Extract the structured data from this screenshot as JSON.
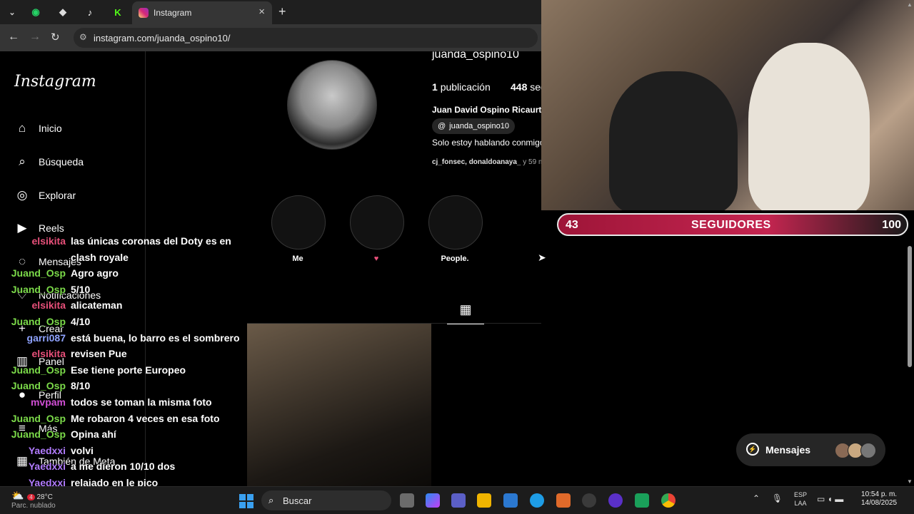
{
  "browser": {
    "tab_title": "Instagram",
    "url": "instagram.com/juanda_ospino10/"
  },
  "instagram": {
    "logo": "Instagram",
    "nav": [
      {
        "label": "Inicio",
        "icon": "home-icon"
      },
      {
        "label": "Búsqueda",
        "icon": "search-icon"
      },
      {
        "label": "Explorar",
        "icon": "compass-icon"
      },
      {
        "label": "Reels",
        "icon": "reels-icon"
      },
      {
        "label": "Mensajes",
        "icon": "messenger-icon"
      },
      {
        "label": "Notificaciones",
        "icon": "heart-icon"
      },
      {
        "label": "Crear",
        "icon": "plus-icon"
      },
      {
        "label": "Panel",
        "icon": "chart-icon"
      },
      {
        "label": "Perfil",
        "icon": "avatar-icon"
      },
      {
        "label": "Más",
        "icon": "menu-icon"
      },
      {
        "label": "También de Meta",
        "icon": "meta-icon"
      }
    ],
    "profile": {
      "username": "juanda_ospino10",
      "posts_count": "1",
      "posts_label": "publicación",
      "followers_count": "448",
      "followers_label": "seg",
      "full_name": "Juan David Ospino Ricaurte",
      "threads_handle": "juanda_ospino10",
      "bio": "Solo estoy hablando conmigo",
      "mutual_names": "cj_fonsec, donaldoanaya_",
      "mutual_more": " y 59 má"
    },
    "highlights": [
      {
        "label": "Me"
      },
      {
        "label": "♥"
      },
      {
        "label": "People."
      }
    ],
    "messages_bar": {
      "label": "Mensajes"
    }
  },
  "stream_overlay": {
    "current": "43",
    "label": "SEGUIDORES",
    "goal": "100",
    "bar_color": "#c42550"
  },
  "chat": [
    {
      "user": "elsikita",
      "msg": "las únicas coronas del Doty es en",
      "color": "#e8507a"
    },
    {
      "user": "",
      "msg": "clash royale",
      "color": "#e8507a"
    },
    {
      "user": "Juand_Osp",
      "msg": "Agro agro",
      "color": "#7cdb4a"
    },
    {
      "user": "Juand_Osp",
      "msg": "5/10",
      "color": "#7cdb4a"
    },
    {
      "user": "elsikita",
      "msg": "alicateman",
      "color": "#e8507a"
    },
    {
      "user": "Juand_Osp",
      "msg": "4/10",
      "color": "#7cdb4a"
    },
    {
      "user": "garri087",
      "msg": "está buena, lo barro es el sombrero",
      "color": "#8fa3ff"
    },
    {
      "user": "elsikita",
      "msg": "revisen Pue",
      "color": "#e8507a"
    },
    {
      "user": "Juand_Osp",
      "msg": "Ese tiene porte Europeo",
      "color": "#7cdb4a"
    },
    {
      "user": "Juand_Osp",
      "msg": "8/10",
      "color": "#7cdb4a"
    },
    {
      "user": "mvpam",
      "msg": "todos se toman la misma foto",
      "color": "#d24fd6"
    },
    {
      "user": "Juand_Osp",
      "msg": "Me robaron 4 veces en esa foto",
      "color": "#7cdb4a"
    },
    {
      "user": "Juand_Osp",
      "msg": "Opina ahí",
      "color": "#7cdb4a"
    },
    {
      "user": "Yaedxxi",
      "msg": "volvi",
      "color": "#b27cff"
    },
    {
      "user": "Yaedxxi",
      "msg": "a me dieron 10/10 dos",
      "color": "#b27cff"
    },
    {
      "user": "Yaedxxi",
      "msg": "relajado en le pico",
      "color": "#b27cff"
    }
  ],
  "taskbar": {
    "temp": "28°C",
    "weather": "Parc. nublado",
    "search_placeholder": "Buscar",
    "lang_top": "ESP",
    "lang_bottom": "LAA",
    "time": "10:54 p. m.",
    "date": "14/08/2025",
    "weather_badge": "4"
  }
}
